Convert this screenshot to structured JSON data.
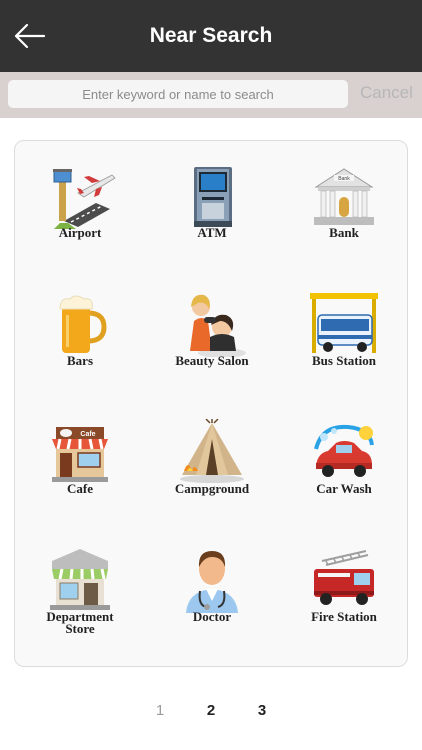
{
  "header": {
    "title": "Near Search",
    "back_icon": "arrow-left-icon"
  },
  "search": {
    "placeholder": "Enter keyword or name to search",
    "value": "",
    "cancel_label": "Cancel"
  },
  "categories": [
    {
      "label": "Airport",
      "icon": "airport-icon"
    },
    {
      "label": "ATM",
      "icon": "atm-icon"
    },
    {
      "label": "Bank",
      "icon": "bank-icon"
    },
    {
      "label": "Bars",
      "icon": "beer-mug-icon"
    },
    {
      "label": "Beauty Salon",
      "icon": "beauty-salon-icon"
    },
    {
      "label": "Bus Station",
      "icon": "bus-icon"
    },
    {
      "label": "Cafe",
      "icon": "cafe-icon"
    },
    {
      "label": "Campground",
      "icon": "tent-campfire-icon"
    },
    {
      "label": "Car Wash",
      "icon": "car-wash-icon"
    },
    {
      "label": "Department Store",
      "icon": "department-store-icon"
    },
    {
      "label": "Doctor",
      "icon": "doctor-icon"
    },
    {
      "label": "Fire Station",
      "icon": "fire-truck-icon"
    }
  ],
  "pagination": {
    "pages": [
      "1",
      "2",
      "3"
    ],
    "current": "1"
  },
  "colors": {
    "header_bg": "#333333",
    "search_bar_bg": "#d9d0d0",
    "panel_bg": "#f9f9f9",
    "page_inactive": "#9b9b9b",
    "page_active": "#222222"
  }
}
